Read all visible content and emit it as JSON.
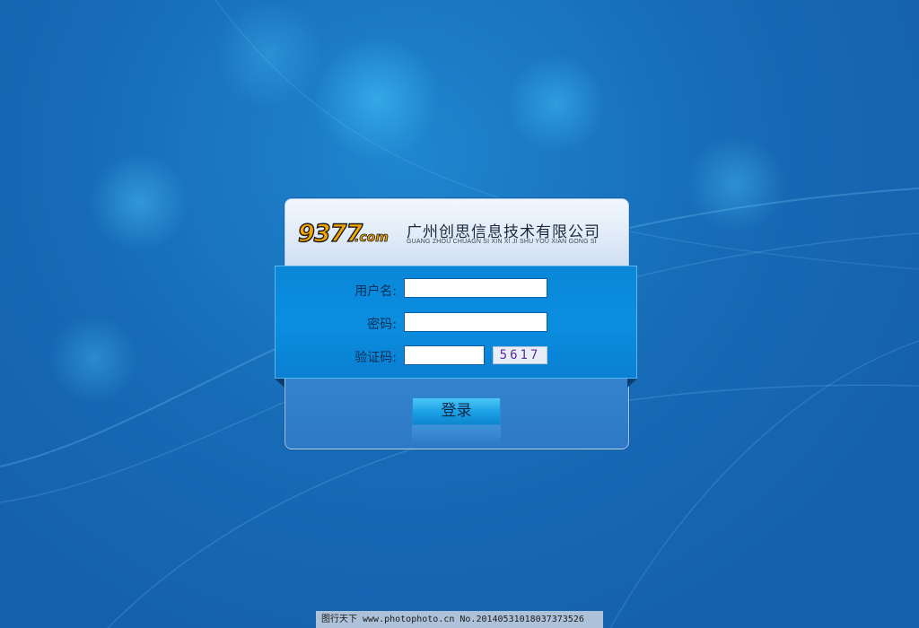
{
  "header": {
    "logo_number": "9377",
    "logo_domain": ".com",
    "company_name": "广州创思信息技术有限公司",
    "company_pinyin": "GUANG ZHOU CHUAGN SI XIN XI JI SHU YOU XIAN GONG SI"
  },
  "form": {
    "username_label": "用户名:",
    "username_value": "",
    "password_label": "密码:",
    "password_value": "",
    "captcha_label": "验证码:",
    "captcha_value": "",
    "captcha_code": "5617"
  },
  "actions": {
    "login_label": "登录"
  },
  "watermark": {
    "text": "图行天下 www.photophoto.cn No.20140531018037373526"
  },
  "colors": {
    "background": "#1664b0",
    "form_band": "#0a86d8",
    "logo_orange": "#f5a600",
    "captcha_text": "#5e2aa3"
  }
}
